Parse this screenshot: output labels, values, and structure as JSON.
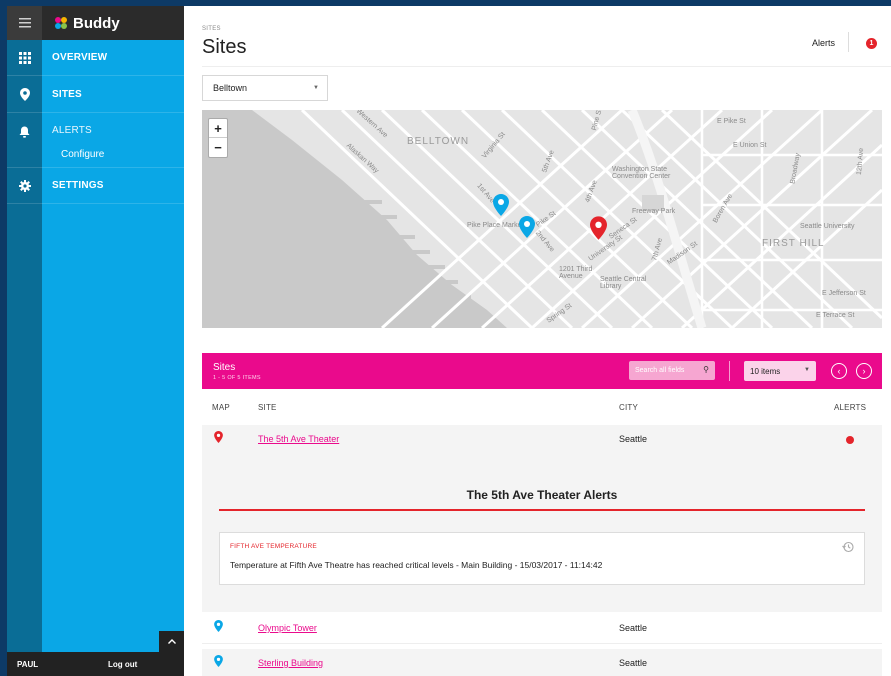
{
  "app": {
    "brand": "Buddy",
    "user": "PAUL",
    "logout_label": "Log out"
  },
  "nav": {
    "items": [
      {
        "label": "OVERVIEW",
        "icon": "grid-icon"
      },
      {
        "label": "SITES",
        "icon": "map-pin-icon"
      },
      {
        "label": "ALERTS",
        "icon": "bell-icon"
      },
      {
        "label": "SETTINGS",
        "icon": "gear-icon"
      }
    ],
    "alerts_sub": "Configure"
  },
  "header": {
    "breadcrumb": "SITES",
    "title": "Sites",
    "alerts_label": "Alerts",
    "alerts_count": "1"
  },
  "filter": {
    "selected": "Belltown"
  },
  "map": {
    "zoom_in": "+",
    "zoom_out": "−",
    "labels": {
      "belltown": "BELLTOWN",
      "first_hill": "FIRST HILL",
      "pike_place": "Pike Place Market",
      "alaskan_way": "Alaskan Way",
      "western_ave": "Western Ave",
      "convention": "Washington State Convention Center",
      "freeway_park": "Freeway Park",
      "library": "Seattle Central Library",
      "third_ave": "1201 Third Avenue",
      "seattle_u": "Seattle University",
      "e_pike": "E Pike St",
      "e_union": "E Union St",
      "university_st": "University St",
      "seneca": "Seneca St",
      "madison": "Madison St",
      "spring": "Spring St",
      "e_terrace": "E Terrace St",
      "e_jefferson": "E Jefferson St",
      "boren": "Boren Ave",
      "broadway": "Broadway",
      "first_ave": "1st Ave",
      "second_ave": "2nd Ave",
      "fourth_ave": "4th Ave",
      "fifth_ave": "5th Ave",
      "virginia": "Virginia St",
      "pike_st": "Pike St",
      "seventh_ave": "7th Ave",
      "twelfth_ave": "12th Ave",
      "pine_st": "Pine St"
    }
  },
  "sites": {
    "title": "Sites",
    "count": "1 - 5 OF 5 ITEMS",
    "search_placeholder": "Search all fields",
    "items_per_page": "10 items",
    "columns": {
      "map": "MAP",
      "site": "SITE",
      "city": "CITY",
      "alerts": "ALERTS"
    },
    "rows": [
      {
        "site": "The 5th Ave Theater",
        "city": "Seattle",
        "alert": true,
        "pin_color": "#e4242b"
      },
      {
        "site": "Olympic Tower",
        "city": "Seattle",
        "alert": false,
        "pin_color": "#0aa7e6"
      },
      {
        "site": "Sterling Building",
        "city": "Seattle",
        "alert": false,
        "pin_color": "#0aa7e6"
      }
    ],
    "expanded": {
      "title": "The 5th Ave Theater Alerts",
      "alert_category": "FIFTH AVE TEMPERATURE",
      "alert_message": "Temperature at Fifth Ave Theatre has reached critical levels - Main Building - 15/03/2017 - 11:14:42"
    }
  },
  "colors": {
    "accent_pink": "#ea0a8c",
    "sidebar_blue": "#0aa7e6",
    "rail_blue": "#0a6d96",
    "alert_red": "#e4242b"
  }
}
